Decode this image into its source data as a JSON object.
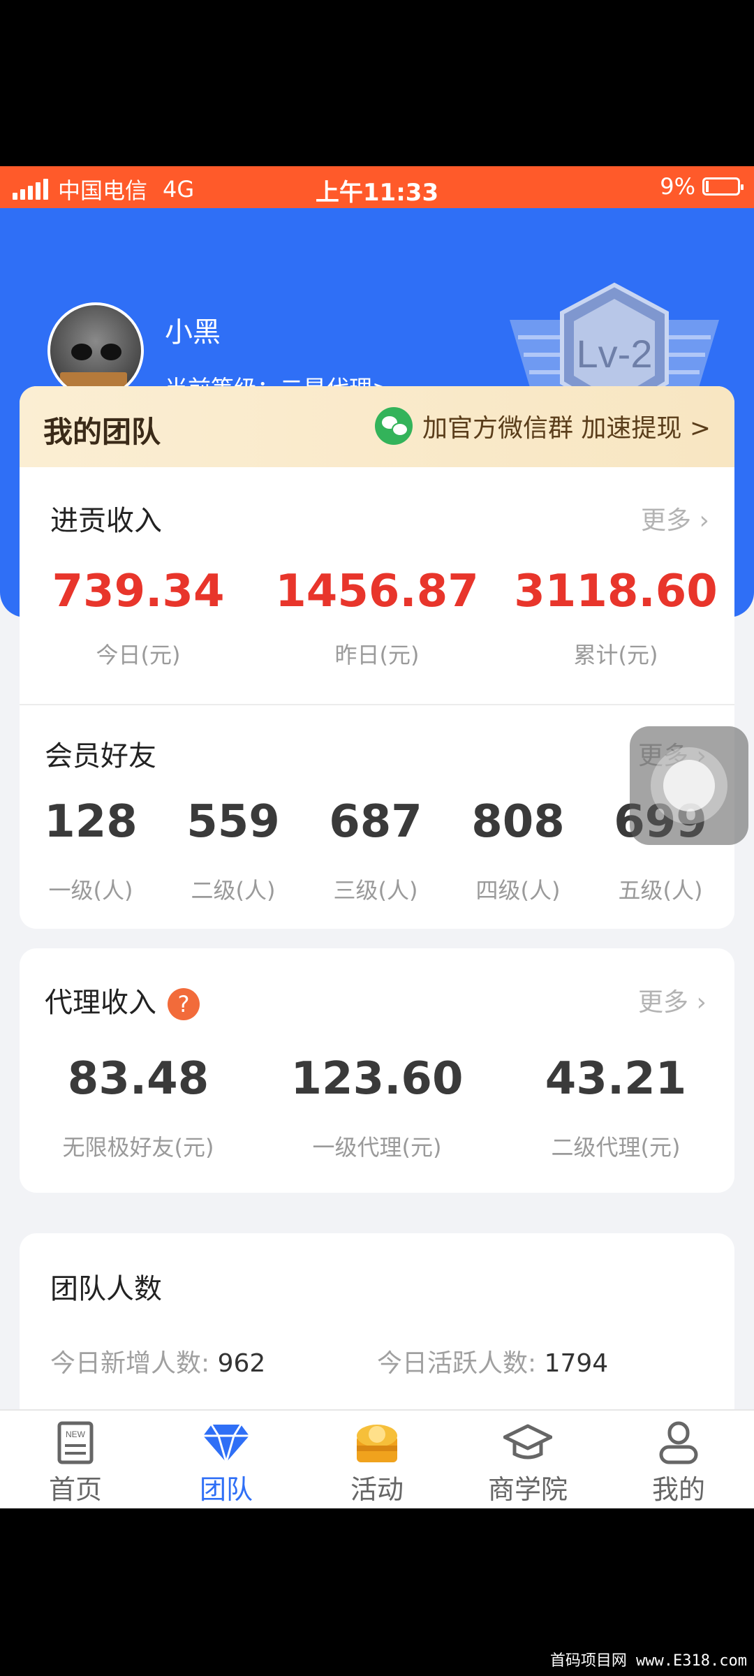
{
  "status_bar": {
    "carrier": "中国电信",
    "network": "4G",
    "time": "上午11:33",
    "battery": "9%",
    "battery_level": 0.09
  },
  "profile": {
    "name": "小黑",
    "level_label": "当前等级：",
    "level_value": "二星代理",
    "chevron": ">",
    "badge_text": "Lv-2"
  },
  "team_bar": {
    "title": "我的团队",
    "wechat_text": "加官方微信群 加速提现 >",
    "icon": "wechat-icon"
  },
  "contribution": {
    "title": "进贡收入",
    "more": "更多",
    "items": [
      {
        "value": "739.34",
        "label": "今日(元)"
      },
      {
        "value": "1456.87",
        "label": "昨日(元)"
      },
      {
        "value": "3118.60",
        "label": "累计(元)"
      }
    ]
  },
  "members": {
    "title": "会员好友",
    "more": "更多",
    "items": [
      {
        "value": "128",
        "label": "一级(人)"
      },
      {
        "value": "559",
        "label": "二级(人)"
      },
      {
        "value": "687",
        "label": "三级(人)"
      },
      {
        "value": "808",
        "label": "四级(人)"
      },
      {
        "value": "699",
        "label": "五级(人)"
      }
    ]
  },
  "agent_income": {
    "title": "代理收入",
    "help_glyph": "?",
    "more": "更多",
    "items": [
      {
        "value": "83.48",
        "label": "无限极好友(元)"
      },
      {
        "value": "123.60",
        "label": "一级代理(元)"
      },
      {
        "value": "43.21",
        "label": "二级代理(元)"
      }
    ]
  },
  "team_count": {
    "title": "团队人数",
    "stats": [
      {
        "label": "今日新增人数:",
        "value": "962"
      },
      {
        "label": "今日活跃人数:",
        "value": "1794"
      }
    ]
  },
  "tabs": [
    {
      "label": "首页",
      "icon": "news-icon",
      "active": false
    },
    {
      "label": "团队",
      "icon": "diamond-icon",
      "active": true
    },
    {
      "label": "活动",
      "icon": "treasure-icon",
      "active": false
    },
    {
      "label": "商学院",
      "icon": "graduation-cap-icon",
      "active": false
    },
    {
      "label": "我的",
      "icon": "person-icon",
      "active": false
    }
  ],
  "colors": {
    "primary_blue": "#2f6ff6",
    "status_orange": "#ff5a2a",
    "income_red": "#e8352b",
    "wechat_green": "#33b35a"
  },
  "watermark": "首码项目网 www.E318.com"
}
